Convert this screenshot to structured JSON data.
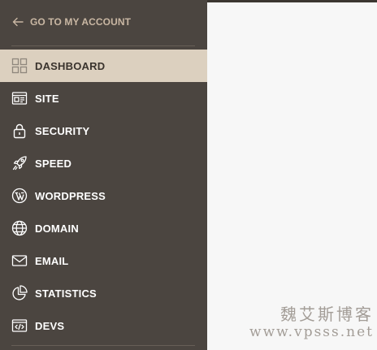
{
  "back_link": {
    "label": "GO TO MY ACCOUNT",
    "icon": "arrow-left-icon"
  },
  "colors": {
    "sidebar_bg": "#4b4540",
    "active_bg": "#dcd0bf",
    "accent_text": "#c9b7a3",
    "content_bg": "#f7f7f7"
  },
  "nav": {
    "active": "DASHBOARD",
    "items": [
      {
        "label": "DASHBOARD",
        "icon": "dashboard-grid-icon"
      },
      {
        "label": "SITE",
        "icon": "site-window-icon"
      },
      {
        "label": "SECURITY",
        "icon": "lock-icon"
      },
      {
        "label": "SPEED",
        "icon": "rocket-icon"
      },
      {
        "label": "WORDPRESS",
        "icon": "wordpress-icon"
      },
      {
        "label": "DOMAIN",
        "icon": "globe-icon"
      },
      {
        "label": "EMAIL",
        "icon": "envelope-icon"
      },
      {
        "label": "STATISTICS",
        "icon": "pie-chart-icon"
      },
      {
        "label": "DEVS",
        "icon": "code-window-icon"
      }
    ]
  },
  "watermark": {
    "line1": "魏艾斯博客",
    "line2": "www.vpsss.net"
  }
}
